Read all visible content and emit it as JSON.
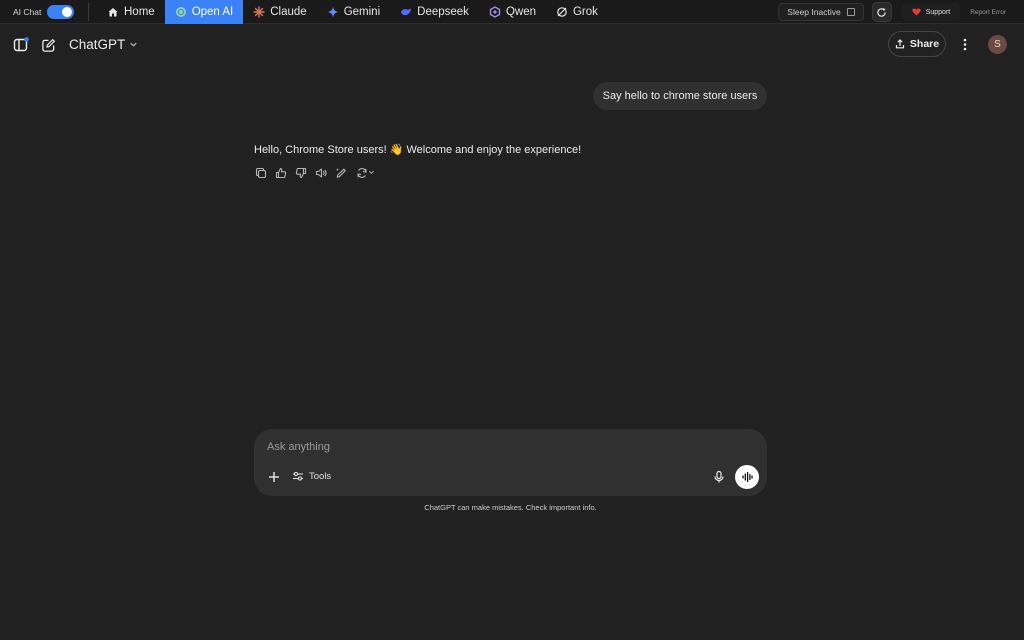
{
  "extension": {
    "ai_chat_label": "AI Chat",
    "ai_chat_enabled": true,
    "tabs": [
      {
        "label": "Home",
        "icon": "home-icon",
        "active": false
      },
      {
        "label": "Open AI",
        "icon": "openai-logo-icon",
        "active": true
      },
      {
        "label": "Claude",
        "icon": "claude-logo-icon",
        "active": false
      },
      {
        "label": "Gemini",
        "icon": "gemini-logo-icon",
        "active": false
      },
      {
        "label": "Deepseek",
        "icon": "deepseek-logo-icon",
        "active": false
      },
      {
        "label": "Qwen",
        "icon": "qwen-logo-icon",
        "active": false
      },
      {
        "label": "Grok",
        "icon": "grok-logo-icon",
        "active": false
      }
    ],
    "sleep_label": "Sleep Inactive",
    "sleep_checked": false,
    "support_label": "Support",
    "report_label": "Report Error",
    "accent_color": "#3b82f6"
  },
  "header": {
    "model_name": "ChatGPT",
    "share_label": "Share",
    "avatar_initial": "S"
  },
  "conversation": {
    "user_message": "Say hello to chrome store users",
    "assistant_reply": "Hello, Chrome Store users! 👋 Welcome and enjoy the experience!"
  },
  "composer": {
    "placeholder": "Ask anything",
    "tools_label": "Tools",
    "disclaimer": "ChatGPT can make mistakes. Check important info."
  }
}
